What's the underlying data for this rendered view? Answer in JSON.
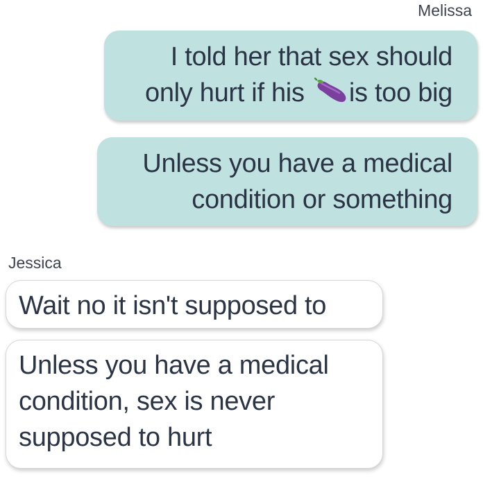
{
  "conversation": {
    "senders": {
      "right": "Melissa",
      "left": "Jessica"
    },
    "messages": [
      {
        "sender": "Melissa",
        "direction": "outgoing",
        "lines": [
          "I told her that sex should",
          {
            "before": "only hurt if his ",
            "emoji": "eggplant-emoji",
            "after": "is too big"
          }
        ]
      },
      {
        "sender": "Melissa",
        "direction": "outgoing",
        "lines": [
          "Unless you have a medical",
          "condition or something"
        ]
      },
      {
        "sender": "Jessica",
        "direction": "incoming",
        "lines": [
          "Wait no it isn't supposed to"
        ]
      },
      {
        "sender": "Jessica",
        "direction": "incoming",
        "lines": [
          "Unless you have a medical",
          "condition, sex is never",
          "supposed to hurt"
        ]
      }
    ]
  },
  "colors": {
    "outgoing_bubble": "#bfe1e0",
    "incoming_bubble": "#ffffff",
    "text": "#2b3445",
    "sender_label": "#3b4250"
  }
}
